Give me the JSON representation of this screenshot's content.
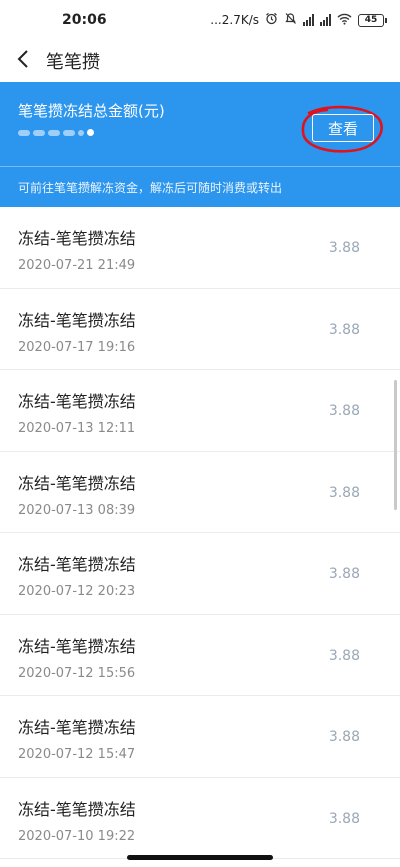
{
  "status_bar": {
    "time": "20:06",
    "network_speed": "...2.7K/s",
    "battery_level": "45"
  },
  "nav": {
    "title": "笔笔攒"
  },
  "header": {
    "label": "笔笔攒冻结总金额(元)",
    "view_button_label": "查看",
    "note": "可前往笔笔攒解冻资金，解冻后可随时消费或转出"
  },
  "records": [
    {
      "title": "冻结-笔笔攒冻结",
      "date": "2020-07-21 21:49",
      "amount": "3.88"
    },
    {
      "title": "冻结-笔笔攒冻结",
      "date": "2020-07-17 19:16",
      "amount": "3.88"
    },
    {
      "title": "冻结-笔笔攒冻结",
      "date": "2020-07-13 12:11",
      "amount": "3.88"
    },
    {
      "title": "冻结-笔笔攒冻结",
      "date": "2020-07-13 08:39",
      "amount": "3.88"
    },
    {
      "title": "冻结-笔笔攒冻结",
      "date": "2020-07-12 20:23",
      "amount": "3.88"
    },
    {
      "title": "冻结-笔笔攒冻结",
      "date": "2020-07-12 15:56",
      "amount": "3.88"
    },
    {
      "title": "冻结-笔笔攒冻结",
      "date": "2020-07-12 15:47",
      "amount": "3.88"
    },
    {
      "title": "冻结-笔笔攒冻结",
      "date": "2020-07-10 19:22",
      "amount": "3.88"
    }
  ],
  "colors": {
    "header_bg": "#2c95ee",
    "annotation_circle": "#e0121b",
    "amount_text": "#9aa7b6"
  },
  "icons": [
    "back-arrow-icon",
    "alarm-icon",
    "mute-icon",
    "signal-icon",
    "wifi-icon",
    "battery-icon"
  ]
}
